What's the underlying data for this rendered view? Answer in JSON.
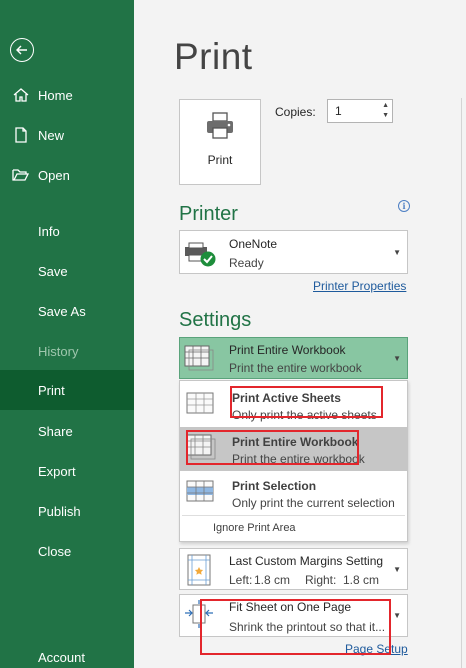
{
  "sidebar": {
    "items": [
      {
        "label": "Home"
      },
      {
        "label": "New"
      },
      {
        "label": "Open"
      },
      {
        "label": "Info"
      },
      {
        "label": "Save"
      },
      {
        "label": "Save As"
      },
      {
        "label": "History"
      },
      {
        "label": "Print"
      },
      {
        "label": "Share"
      },
      {
        "label": "Export"
      },
      {
        "label": "Publish"
      },
      {
        "label": "Close"
      },
      {
        "label": "Account"
      }
    ],
    "selected": "Print",
    "background_color": "#217346",
    "selected_color": "#0e5c2f"
  },
  "main": {
    "title": "Print",
    "print_button_label": "Print",
    "copies": {
      "label": "Copies:",
      "value": "1"
    },
    "printer": {
      "heading": "Printer",
      "name": "OneNote",
      "status": "Ready",
      "properties_link": "Printer Properties"
    },
    "settings": {
      "heading": "Settings",
      "scope": {
        "title": "Print Entire Workbook",
        "subtitle": "Print the entire workbook"
      },
      "scope_options": [
        {
          "title": "Print Active Sheets",
          "subtitle": "Only print the active sheets"
        },
        {
          "title": "Print Entire Workbook",
          "subtitle": "Print the entire workbook"
        },
        {
          "title": "Print Selection",
          "subtitle": "Only print the current selection"
        }
      ],
      "ignore_print_area": "Ignore Print Area",
      "margins": {
        "title": "Last Custom Margins Setting",
        "left_label": "Left:",
        "left_value": "1.8 cm",
        "right_label": "Right:",
        "right_value": "1.8 cm"
      },
      "scaling": {
        "title": "Fit Sheet on One Page",
        "subtitle": "Shrink the printout so that it..."
      },
      "page_setup_link": "Page Setup"
    },
    "accent_color": "#217346",
    "annotation_color": "#e3262c"
  }
}
